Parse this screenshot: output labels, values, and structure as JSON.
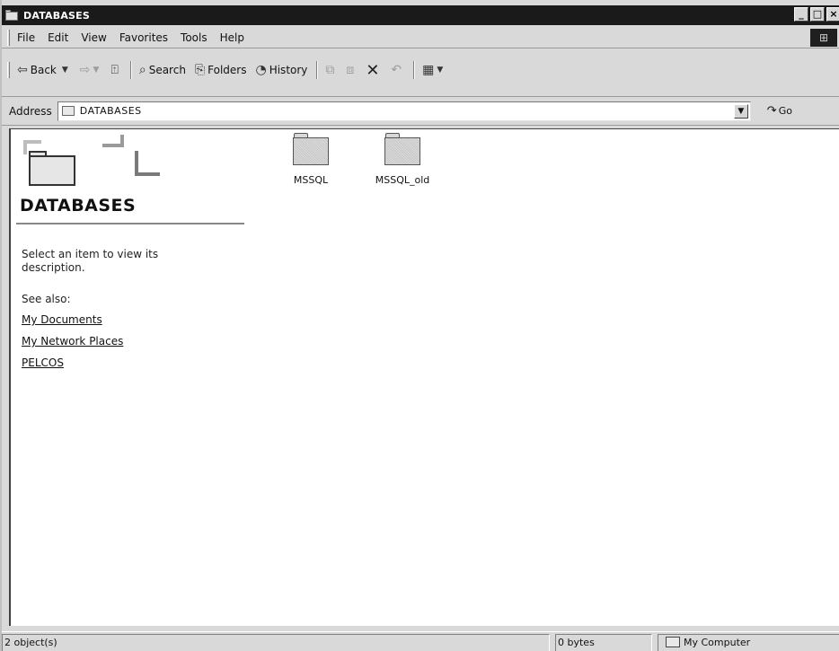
{
  "window": {
    "title": "DATABASES"
  },
  "menu": {
    "items": [
      "File",
      "Edit",
      "View",
      "Favorites",
      "Tools",
      "Help"
    ]
  },
  "toolbar": {
    "back": "Back",
    "search": "Search",
    "folders": "Folders",
    "history": "History"
  },
  "address": {
    "label": "Address",
    "value": "DATABASES",
    "go": "Go"
  },
  "infopane": {
    "title": "DATABASES",
    "description": "Select an item to view its description.",
    "see_also": "See also:",
    "links": [
      "My Documents",
      "My Network Places",
      "PELCOS"
    ]
  },
  "files": [
    {
      "name": "MSSQL",
      "icon": "folder-icon"
    },
    {
      "name": "MSSQL_old",
      "icon": "folder-icon"
    }
  ],
  "status": {
    "objects": "2 object(s)",
    "size": "0 bytes",
    "zone": "My Computer"
  }
}
